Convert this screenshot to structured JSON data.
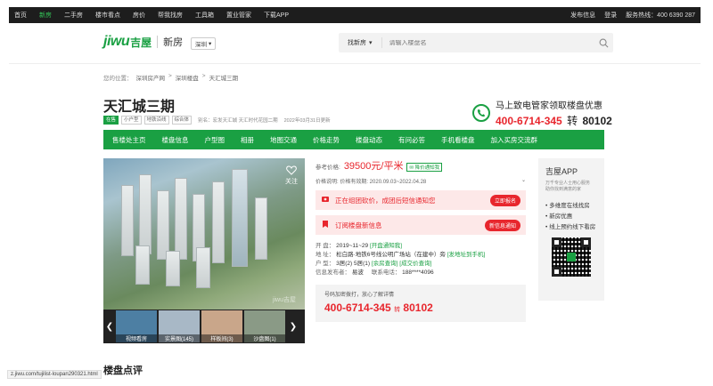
{
  "topnav": {
    "items": [
      "首页",
      "新房",
      "二手房",
      "楼市看点",
      "房价",
      "帮我找房",
      "工具箱",
      "置业管家",
      "下载APP"
    ],
    "active_index": 1,
    "right_items": [
      "发布信息",
      "登录"
    ],
    "hotline": "服务热线：400 6390 287"
  },
  "header": {
    "logo_en": "jiwu",
    "logo_cn": "吉屋",
    "section": "新房",
    "city": "深圳",
    "search_type": "找新房",
    "search_placeholder": "请输入楼盘名"
  },
  "breadcrumb": {
    "prefix": "您的位置：",
    "items": [
      "深圳房产网",
      "深圳楼盘",
      "天汇城三期"
    ],
    "sep": ">"
  },
  "project": {
    "title": "天汇城三期",
    "tags": [
      "在售",
      "小户型",
      "地铁沿线",
      "综合体"
    ],
    "alias": "别名：宏发天汇城 天汇时代花园二期",
    "updated": "2022年03月31日更新"
  },
  "promo": {
    "line1": "马上致电管家领取楼盘优惠",
    "phone": "400-6714-345",
    "zhuan": "转",
    "ext": "80102"
  },
  "green_nav": [
    "售楼处主页",
    "楼盘信息",
    "户型图",
    "相册",
    "地图交通",
    "价格走势",
    "楼盘动态",
    "有问必答",
    "手机看楼盘",
    "加入买房交流群"
  ],
  "gallery": {
    "fav_label": "关注",
    "watermark": "jiwu吉屋",
    "thumbs": [
      {
        "label": "视频看房",
        "color": "#4d7fa3"
      },
      {
        "label": "实景图(145)",
        "color": "#a8b8c6"
      },
      {
        "label": "样板间(3)",
        "color": "#c9a68a"
      },
      {
        "label": "沙盘图(1)",
        "color": "#8a9a86"
      }
    ]
  },
  "info": {
    "price_label": "参考价格:",
    "price": "39500元/平米",
    "price_notice": "降价通知我",
    "validity_label": "价格说明:",
    "validity": "价格有效期: 2020.09.03~2022.04.28",
    "promo_msg": "正在组团砍价，成团后短信通知您",
    "promo_btn": "立即报名",
    "sub_msg": "订阅楼盘新信息",
    "sub_btn": "新信息通知",
    "open_label": "开  盘：",
    "open_value": "2019~11~29",
    "open_link": "[开盘通知我]",
    "addr_label": "地  址：",
    "addr_value": "松白路·地铁6号线公明广场站（在建中）旁",
    "addr_link": "[发地址到手机]",
    "layout_label": "户  型：",
    "layout_value": "3居(2)    5居(1)",
    "layout_link": "[余房查询] [成交价查询]",
    "publisher_label": "信息发布者：",
    "publisher": "易波",
    "contact_label": "联系电话：",
    "contact": "188****4096",
    "call_note": "号码加密拨打，放心了解详情",
    "call_phone": "400-6714-345",
    "call_zhuan": "转",
    "call_ext": "80102"
  },
  "app": {
    "title": "吉屋APP",
    "sub": "万千专业人士用心服务\n助你找到满意的家",
    "bullets": [
      "多维度在线找房",
      "新房优惠",
      "线上预约线下看房"
    ]
  },
  "section_title": "楼盘点评",
  "status_url": "z.jiwu.com/tujilist-loupan290321.html"
}
